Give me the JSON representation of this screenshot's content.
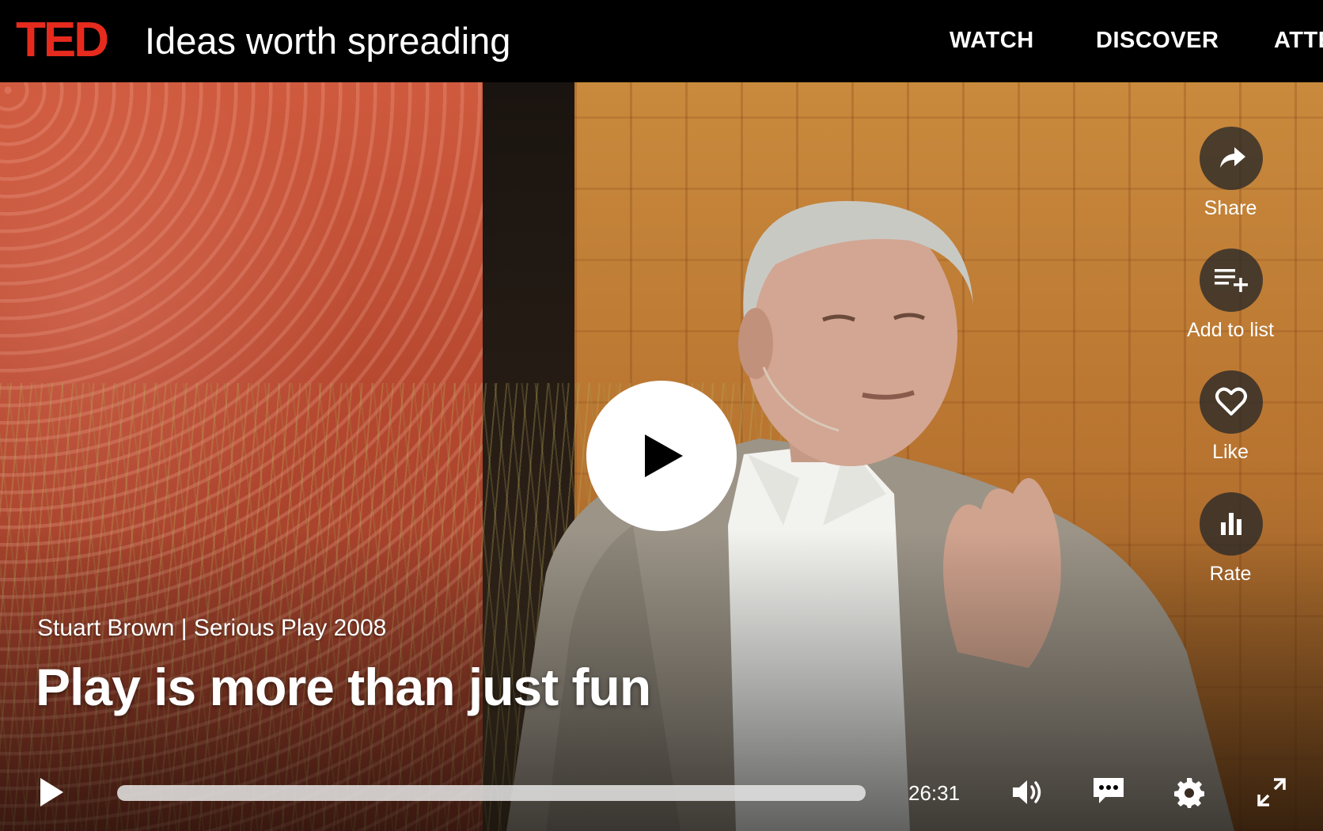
{
  "header": {
    "logo": "TED",
    "tagline": "Ideas worth spreading",
    "nav": [
      "WATCH",
      "DISCOVER",
      "ATTE"
    ]
  },
  "video": {
    "speaker_event": "Stuart Brown | Serious Play 2008",
    "title": "Play is more than just fun",
    "duration": "26:31",
    "progress_fraction": 0
  },
  "actions": [
    {
      "label": "Share",
      "icon": "share-icon"
    },
    {
      "label": "Add to list",
      "icon": "add-to-list-icon"
    },
    {
      "label": "Like",
      "icon": "heart-icon"
    },
    {
      "label": "Rate",
      "icon": "bar-chart-icon"
    }
  ],
  "controls": {
    "icons": [
      "play-icon",
      "volume-icon",
      "subtitles-icon",
      "settings-gear-icon",
      "fullscreen-icon"
    ]
  },
  "colors": {
    "brand": "#e62b1e",
    "topbar": "#000000",
    "text": "#ffffff"
  }
}
